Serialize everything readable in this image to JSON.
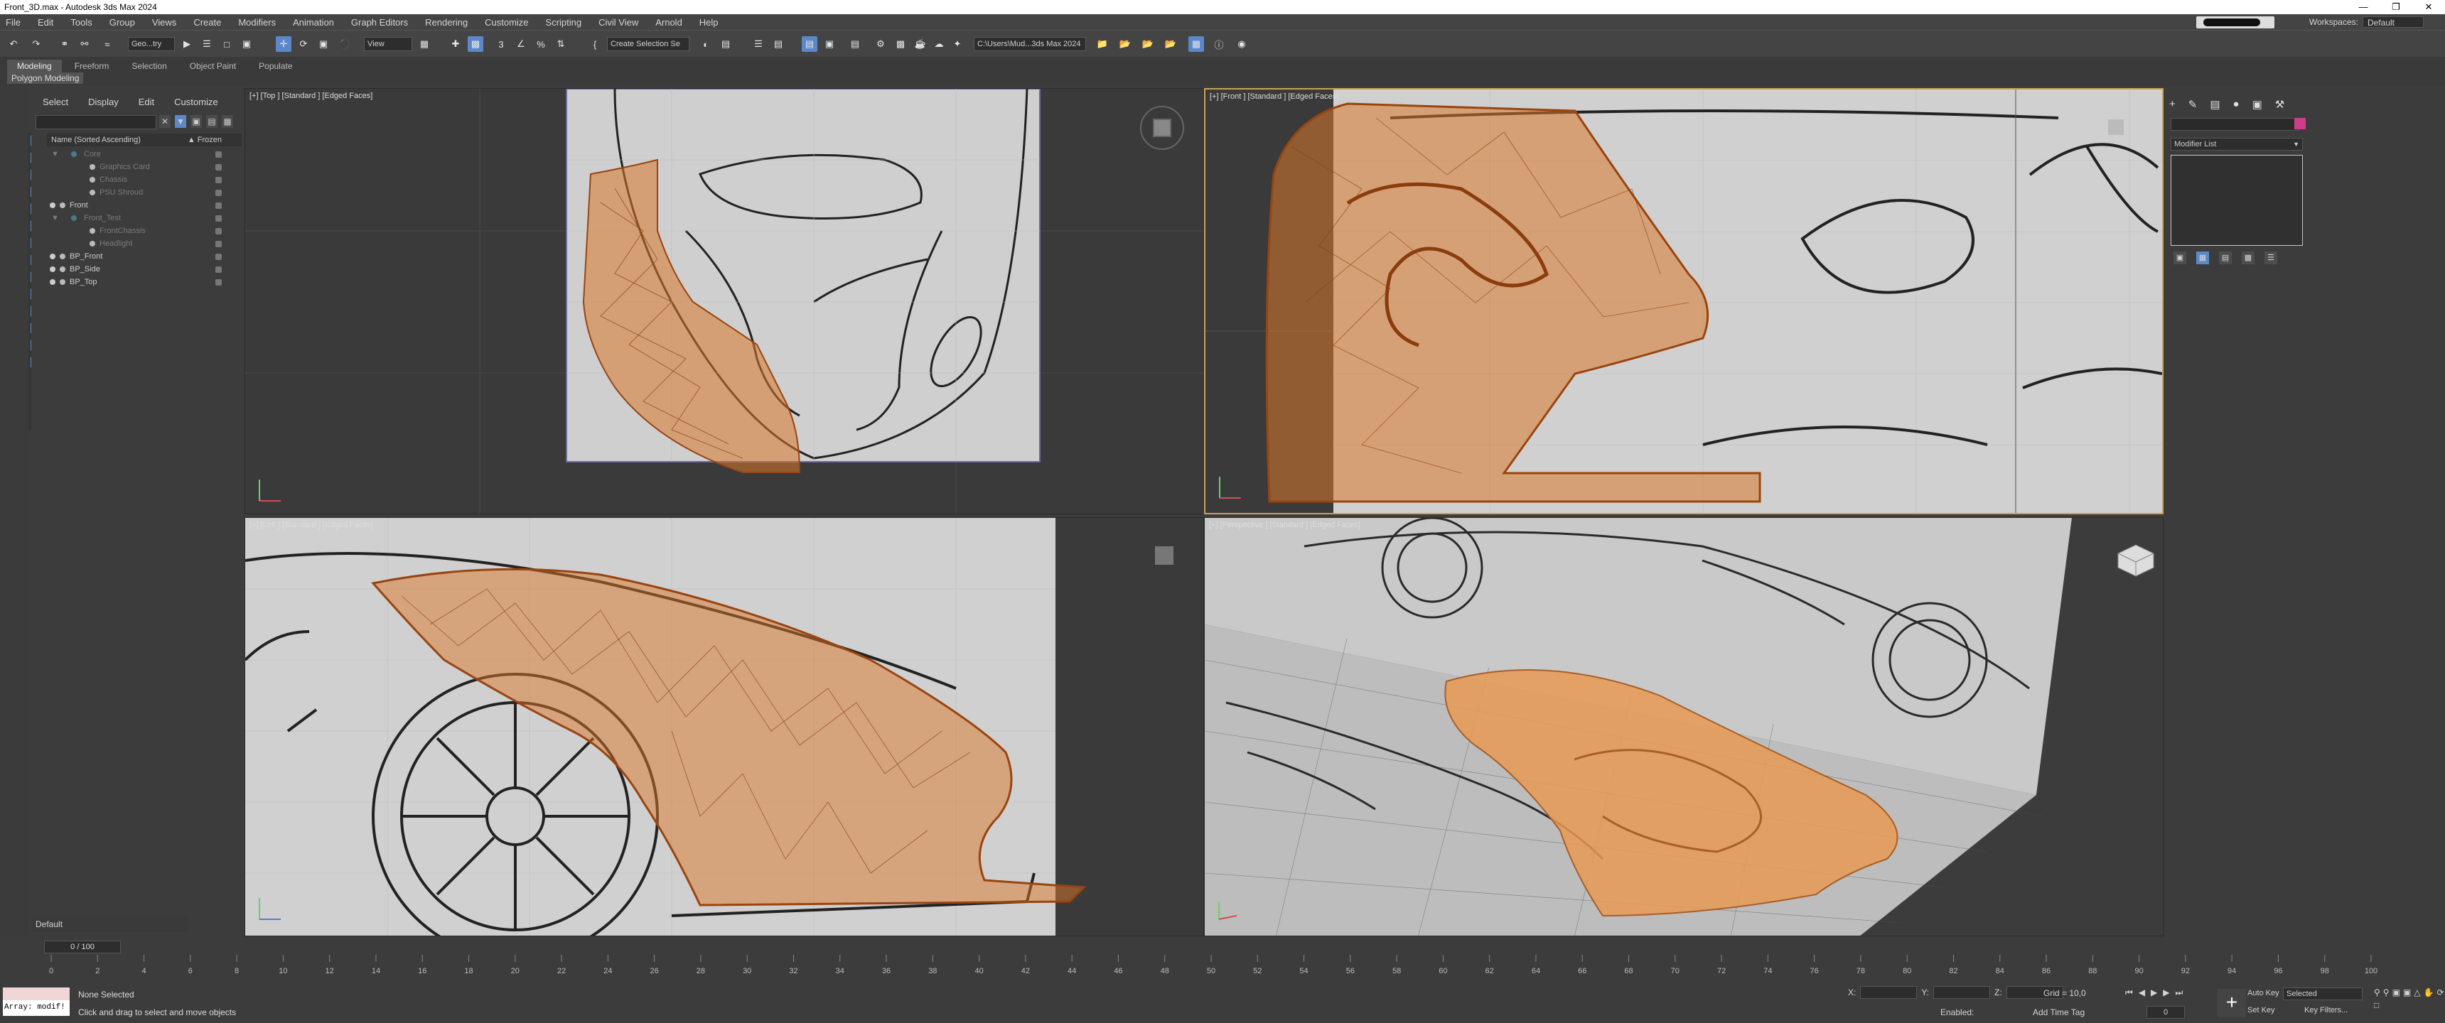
{
  "window": {
    "title": "Front_3D.max - Autodesk 3ds Max 2024"
  },
  "menu": [
    "File",
    "Edit",
    "Tools",
    "Group",
    "Views",
    "Create",
    "Modifiers",
    "Animation",
    "Graph Editors",
    "Rendering",
    "Customize",
    "Scripting",
    "Civil View",
    "Arnold",
    "Help"
  ],
  "workspace": {
    "label": "Workspaces:",
    "value": "Default"
  },
  "toolbar": {
    "filter": "Geo...try",
    "refcoord": "View",
    "selset": "Create Selection Se",
    "path": "C:\\Users\\Mud...3ds Max 2024"
  },
  "ribbon": {
    "tabs": [
      "Modeling",
      "Freeform",
      "Selection",
      "Object Paint",
      "Populate"
    ],
    "sub": "Polygon Modeling"
  },
  "scene": {
    "tabs": [
      "Select",
      "Display",
      "Edit",
      "Customize"
    ],
    "header": "Name (Sorted Ascending)",
    "frozen_col": "▲ Frozen",
    "rows": [
      {
        "name": "Core",
        "dim": true
      },
      {
        "name": "Graphics Card",
        "dim": true
      },
      {
        "name": "Chassis",
        "dim": true
      },
      {
        "name": "PSU Shroud",
        "dim": true
      },
      {
        "name": "Front",
        "dim": false
      },
      {
        "name": "Front_Test",
        "dim": true
      },
      {
        "name": "FrontChassis",
        "dim": true
      },
      {
        "name": "Headlight",
        "dim": true
      },
      {
        "name": "BP_Front",
        "dim": false
      },
      {
        "name": "BP_Side",
        "dim": false
      },
      {
        "name": "BP_Top",
        "dim": false
      }
    ]
  },
  "viewports": {
    "top": "[+] [Top ] [Standard ] [Edged Faces]",
    "front": "[+] [Front ] [Standard ] [Edged Faces]",
    "left": "[+] [Left ] [Standard ] [Edged Faces]",
    "persp": "[+] [Perspective ] [Standard ] [Edged Faces]"
  },
  "command": {
    "modlist": "Modifier List"
  },
  "layer": {
    "name": "Default"
  },
  "timeline": {
    "frame": "0 / 100",
    "ticks": [
      "0",
      "2",
      "4",
      "6",
      "8",
      "10",
      "12",
      "14",
      "16",
      "18",
      "20",
      "22",
      "24",
      "26",
      "28",
      "30",
      "32",
      "34",
      "36",
      "38",
      "40",
      "42",
      "44",
      "46",
      "48",
      "50",
      "52",
      "54",
      "56",
      "58",
      "60",
      "62",
      "64",
      "66",
      "68",
      "70",
      "72",
      "74",
      "76",
      "78",
      "80",
      "82",
      "84",
      "86",
      "88",
      "90",
      "92",
      "94",
      "96",
      "98",
      "100"
    ]
  },
  "status": {
    "maxscript": "Array: modif!",
    "selection": "None Selected",
    "prompt": "Click and drag to select and move objects",
    "x": "X:",
    "y": "Y:",
    "z": "Z:",
    "grid": "Grid = 10,0",
    "enabled": "Enabled:",
    "addtag": "Add Time Tag",
    "autokey": "Auto Key",
    "setkey": "Set Key",
    "selected": "Selected",
    "keyfilters": "Key Filters...",
    "frame": "0"
  },
  "colors": {
    "accent": "#5a88c8",
    "mesh": "#d9782a",
    "viewport_bg": "#3a3a3a",
    "active_border": "#c7a35a"
  }
}
